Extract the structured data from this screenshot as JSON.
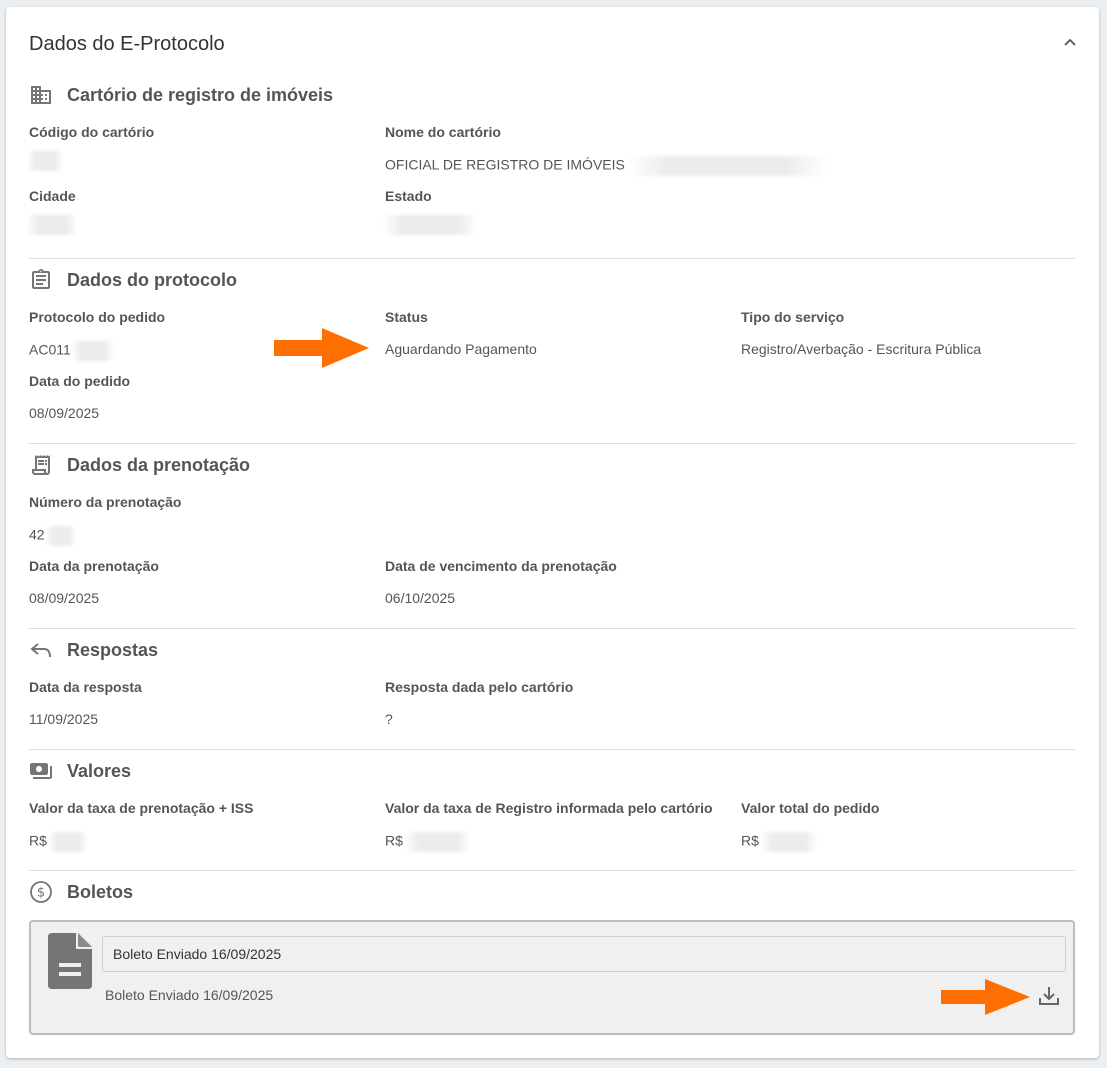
{
  "card": {
    "title": "Dados do E-Protocolo",
    "collapse_icon": "chevron-up-icon"
  },
  "cartorio": {
    "title": "Cartório de registro de imóveis",
    "icon": "building-icon",
    "codigo_label": "Código do cartório",
    "nome_label": "Nome do cartório",
    "nome_value": "OFICIAL DE REGISTRO DE IMÓVEIS",
    "cidade_label": "Cidade",
    "estado_label": "Estado"
  },
  "protocolo": {
    "title": "Dados do protocolo",
    "icon": "clipboard-icon",
    "protocolo_label": "Protocolo do pedido",
    "protocolo_value": "AC011",
    "status_label": "Status",
    "status_value": "Aguardando Pagamento",
    "tipo_label": "Tipo do serviço",
    "tipo_value": "Registro/Averbação - Escritura Pública",
    "data_label": "Data do pedido",
    "data_value": "08/09/2025"
  },
  "prenotacao": {
    "title": "Dados da prenotação",
    "icon": "receipt-icon",
    "numero_label": "Número da prenotação",
    "numero_value": "42",
    "data_label": "Data da prenotação",
    "data_value": "08/09/2025",
    "vencimento_label": "Data de vencimento da prenotação",
    "vencimento_value": "06/10/2025"
  },
  "respostas": {
    "title": "Respostas",
    "icon": "reply-icon",
    "data_label": "Data da resposta",
    "data_value": "11/09/2025",
    "resposta_label": "Resposta dada pelo cartório",
    "resposta_value": "?"
  },
  "valores": {
    "title": "Valores",
    "icon": "cash-icon",
    "prenotacao_label": "Valor da taxa de prenotação + ISS",
    "prenotacao_value": "R$",
    "registro_label": "Valor da taxa de Registro informada pelo cartório",
    "registro_value": "R$",
    "total_label": "Valor total do pedido",
    "total_value": "R$"
  },
  "boletos": {
    "title": "Boletos",
    "icon": "dollar-circle-icon",
    "items": [
      {
        "title": "Boleto Enviado 16/09/2025",
        "subtitle": "Boleto Enviado 16/09/2025",
        "icon": "file-document-icon",
        "action_icon": "download-icon"
      }
    ]
  },
  "colors": {
    "annotation_arrow": "#ff6f00",
    "icon_gray": "#757575",
    "divider": "#dedede"
  }
}
